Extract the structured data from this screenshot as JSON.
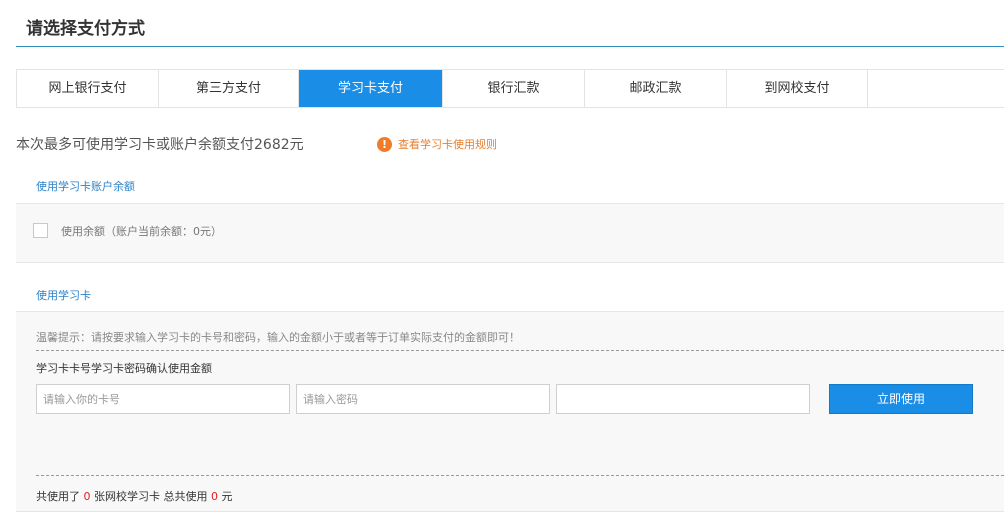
{
  "page": {
    "title": "请选择支付方式"
  },
  "tabs": [
    {
      "label": "网上银行支付",
      "width": 142,
      "active": false
    },
    {
      "label": "第三方支付",
      "width": 140,
      "active": false
    },
    {
      "label": "学习卡支付",
      "width": 144,
      "active": true
    },
    {
      "label": "银行汇款",
      "width": 142,
      "active": false
    },
    {
      "label": "邮政汇款",
      "width": 142,
      "active": false
    },
    {
      "label": "到网校支付",
      "width": 142,
      "active": false
    }
  ],
  "notice": {
    "text": "本次最多可使用学习卡或账户余额支付2682元",
    "rules_link": "查看学习卡使用规则",
    "rules_icon": "!"
  },
  "balance": {
    "section_label": "使用学习卡账户余额",
    "checkbox_label": "使用余额（账户当前余额：0元）"
  },
  "card": {
    "section_label": "使用学习卡",
    "tip": "温馨提示：请按要求输入学习卡的卡号和密码，输入的金额小于或者等于订单实际支付的金额即可！",
    "column_headers": "学习卡卡号学习卡密码确认使用金额",
    "card_number_placeholder": "请输入你的卡号",
    "password_placeholder": "请输入密码",
    "amount_placeholder": "",
    "use_button": "立即使用",
    "summary": {
      "prefix": "共使用了",
      "card_count": "0",
      "middle": "张网校学习卡 总共使用",
      "total_amount": "0",
      "suffix": "元"
    }
  },
  "colors": {
    "accent": "#1a8ee6",
    "link": "#2b82c9",
    "warning": "#f07b2a",
    "highlight": "#e02020"
  }
}
